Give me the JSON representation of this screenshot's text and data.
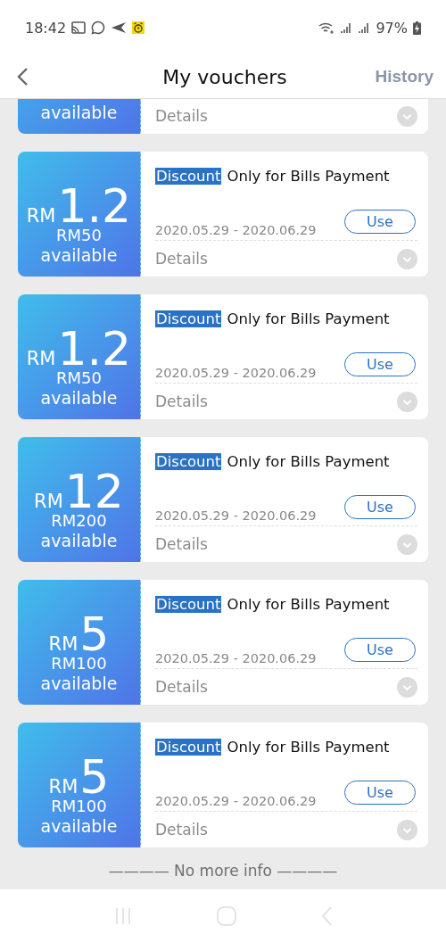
{
  "status_bar": {
    "time": "18:42",
    "battery": "97%"
  },
  "header": {
    "title": "My vouchers",
    "action": "History"
  },
  "vouchers": [
    {
      "available": "available",
      "details": "Details"
    },
    {
      "currency": "RM",
      "amount": "1.2",
      "min_spend": "RM50",
      "available": "available",
      "tag": "Discount",
      "title": "Only for Bills Payment",
      "dates": "2020.05.29 - 2020.06.29",
      "button": "Use",
      "details": "Details"
    },
    {
      "currency": "RM",
      "amount": "1.2",
      "min_spend": "RM50",
      "available": "available",
      "tag": "Discount",
      "title": "Only for Bills Payment",
      "dates": "2020.05.29 - 2020.06.29",
      "button": "Use",
      "details": "Details"
    },
    {
      "currency": "RM",
      "amount": "12",
      "min_spend": "RM200",
      "available": "available",
      "tag": "Discount",
      "title": "Only for Bills Payment",
      "dates": "2020.05.29 - 2020.06.29",
      "button": "Use",
      "details": "Details"
    },
    {
      "currency": "RM",
      "amount": "5",
      "min_spend": "RM100",
      "available": "available",
      "tag": "Discount",
      "title": "Only for Bills Payment",
      "dates": "2020.05.29 - 2020.06.29",
      "button": "Use",
      "details": "Details"
    },
    {
      "currency": "RM",
      "amount": "5",
      "min_spend": "RM100",
      "available": "available",
      "tag": "Discount",
      "title": "Only for Bills Payment",
      "dates": "2020.05.29 - 2020.06.29",
      "button": "Use",
      "details": "Details"
    }
  ],
  "footer": {
    "text": "———— No more info ————"
  }
}
